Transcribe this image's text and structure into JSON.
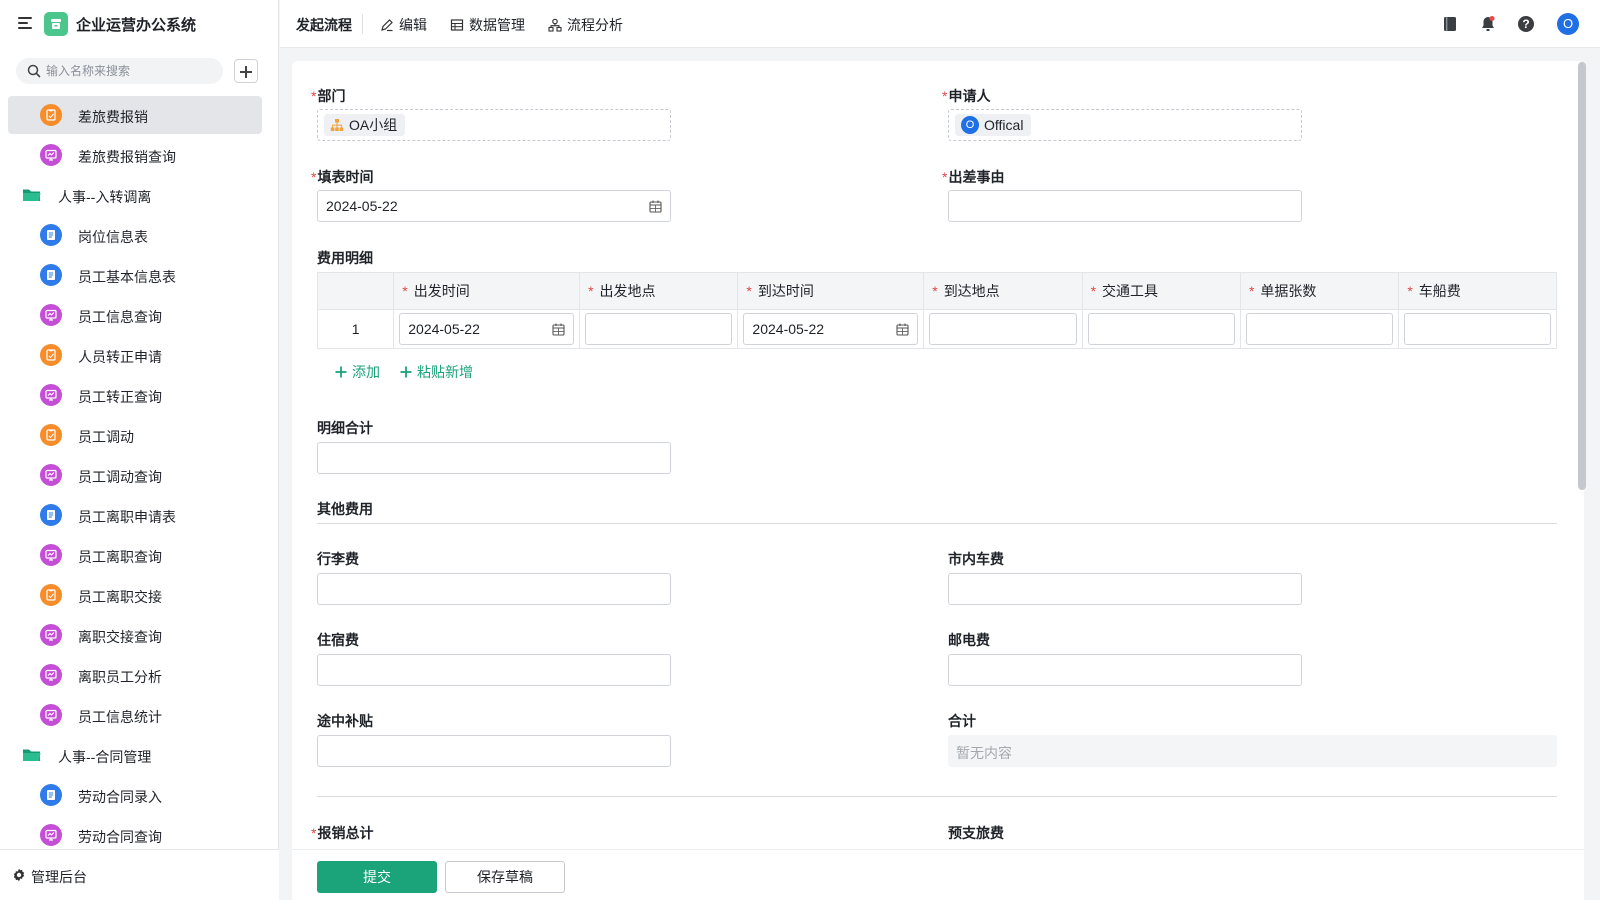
{
  "app": {
    "title": "企业运营办公系统"
  },
  "sidebar": {
    "search_placeholder": "输入名称来搜索",
    "items": [
      {
        "label": "差旅费报销",
        "icon": "form-icon",
        "color": "orange",
        "active": true
      },
      {
        "label": "差旅费报销查询",
        "icon": "report-icon",
        "color": "purple"
      },
      {
        "label": "人事--入转调离",
        "icon": "folder-icon",
        "folder": true
      },
      {
        "label": "岗位信息表",
        "icon": "document-icon",
        "color": "blue"
      },
      {
        "label": "员工基本信息表",
        "icon": "document-icon",
        "color": "blue"
      },
      {
        "label": "员工信息查询",
        "icon": "report-icon",
        "color": "purple"
      },
      {
        "label": "人员转正申请",
        "icon": "form-icon",
        "color": "orange"
      },
      {
        "label": "员工转正查询",
        "icon": "report-icon",
        "color": "purple"
      },
      {
        "label": "员工调动",
        "icon": "form-icon",
        "color": "orange"
      },
      {
        "label": "员工调动查询",
        "icon": "report-icon",
        "color": "purple"
      },
      {
        "label": "员工离职申请表",
        "icon": "document-icon",
        "color": "blue"
      },
      {
        "label": "员工离职查询",
        "icon": "report-icon",
        "color": "purple"
      },
      {
        "label": "员工离职交接",
        "icon": "form-icon",
        "color": "orange"
      },
      {
        "label": "离职交接查询",
        "icon": "report-icon",
        "color": "purple"
      },
      {
        "label": "离职员工分析",
        "icon": "report-icon",
        "color": "purple"
      },
      {
        "label": "员工信息统计",
        "icon": "report-icon",
        "color": "purple"
      },
      {
        "label": "人事--合同管理",
        "icon": "folder-icon",
        "folder": true
      },
      {
        "label": "劳动合同录入",
        "icon": "document-icon",
        "color": "blue"
      },
      {
        "label": "劳动合同查询",
        "icon": "report-icon",
        "color": "purple"
      }
    ],
    "admin_label": "管理后台"
  },
  "topbar": {
    "tabs": [
      "发起流程",
      "编辑",
      "数据管理",
      "流程分析"
    ],
    "avatar_letter": "O"
  },
  "form": {
    "department": {
      "label": "部门",
      "value": "OA小组"
    },
    "applicant": {
      "label": "申请人",
      "value": "Offical",
      "avatar_letter": "O"
    },
    "fill_date": {
      "label": "填表时间",
      "value": "2024-05-22"
    },
    "trip_reason": {
      "label": "出差事由",
      "value": ""
    },
    "expense_detail": {
      "title": "费用明细",
      "columns": [
        "出发时间",
        "出发地点",
        "到达时间",
        "到达地点",
        "交通工具",
        "单据张数",
        "车船费"
      ],
      "rows": [
        {
          "index": "1",
          "depart_time": "2024-05-22",
          "depart_place": "",
          "arrive_time": "2024-05-22",
          "arrive_place": "",
          "transport": "",
          "receipts": "",
          "fare": ""
        }
      ],
      "add_label": "添加",
      "paste_label": "粘贴新增"
    },
    "detail_total": {
      "label": "明细合计",
      "value": ""
    },
    "other_fees": {
      "title": "其他费用",
      "luggage": {
        "label": "行李费",
        "value": ""
      },
      "local_transport": {
        "label": "市内车费",
        "value": ""
      },
      "lodging": {
        "label": "住宿费",
        "value": ""
      },
      "postage": {
        "label": "邮电费",
        "value": ""
      },
      "allowance": {
        "label": "途中补贴",
        "value": ""
      },
      "subtotal": {
        "label": "合计",
        "empty_text": "暂无内容"
      }
    },
    "reimburse_total": {
      "label": "报销总计"
    },
    "advance": {
      "label": "预支旅费"
    }
  },
  "actions": {
    "submit": "提交",
    "save_draft": "保存草稿"
  },
  "colors": {
    "primary": "#1ba37a",
    "required": "#e54545",
    "orange": "#f78c2b",
    "purple": "#c44fd6",
    "blue": "#2f7bea",
    "folder": "#1ba37a"
  }
}
